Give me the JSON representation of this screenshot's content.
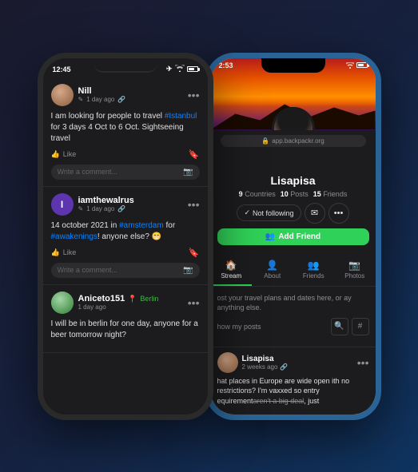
{
  "scene": {
    "background": "#1a1a2e"
  },
  "left_phone": {
    "status_bar": {
      "time": "12:45",
      "icons": [
        "plane",
        "wifi",
        "battery"
      ]
    },
    "posts": [
      {
        "username": "Nill",
        "meta": "1 day ago",
        "has_link": true,
        "avatar_type": "image",
        "text_parts": [
          {
            "text": "I am looking for people to travel ",
            "type": "normal"
          },
          {
            "text": "#Istanbul",
            "type": "hashtag"
          },
          {
            "text": " for 3 days 4 Oct to 6 Oct. Sightseeing travel",
            "type": "normal"
          }
        ],
        "like_label": "Like",
        "comment_placeholder": "Write a comment..."
      },
      {
        "username": "iamthewalrus",
        "meta": "1 day ago",
        "has_link": true,
        "avatar_type": "letter",
        "avatar_letter": "I",
        "text_parts": [
          {
            "text": "14 october 2021 in ",
            "type": "normal"
          },
          {
            "text": "#amsterdam",
            "type": "hashtag"
          },
          {
            "text": " for ",
            "type": "normal"
          },
          {
            "text": "#awakenings",
            "type": "hashtag"
          },
          {
            "text": "! anyone else? 😁",
            "type": "normal"
          }
        ],
        "like_label": "Like",
        "comment_placeholder": "Write a comment..."
      },
      {
        "username": "Aniceto151",
        "location": "Berlin",
        "meta": "1 day ago",
        "avatar_type": "image",
        "text": "I will be in berlin for one day, anyone for a beer tomorrow night?"
      }
    ]
  },
  "right_phone": {
    "status_bar": {
      "time": "2:53",
      "icons": [
        "wifi",
        "battery"
      ]
    },
    "url": "app.backpackr.org",
    "profile": {
      "name": "Lisapisa",
      "stats": {
        "countries": {
          "value": "9",
          "label": "Countries"
        },
        "posts": {
          "value": "10",
          "label": "Posts"
        },
        "friends": {
          "value": "15",
          "label": "Friends"
        }
      },
      "not_following_label": "Not following",
      "add_friend_label": "Add Friend"
    },
    "tabs": [
      {
        "label": "Stream",
        "icon": "home",
        "active": true
      },
      {
        "label": "About",
        "icon": "person",
        "active": false
      },
      {
        "label": "Friends",
        "icon": "group",
        "active": false
      },
      {
        "label": "Photos",
        "icon": "camera",
        "active": false
      }
    ],
    "about_text": "ost your travel plans and dates here, or ay anything else.",
    "show_posts": "how my posts",
    "post": {
      "username": "Lisapisa",
      "meta": "2 weeks ago",
      "has_link": true,
      "text_normal": "hat places in Europe are wide open ith no restrictions? I'm vaxxed so entry equirement",
      "text_strikethrough": "aren't a big deal",
      "text_end": ", just"
    }
  }
}
